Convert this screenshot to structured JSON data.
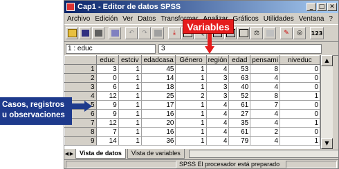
{
  "window": {
    "title": "Cap1 - Editor de datos SPSS"
  },
  "menu": [
    "Archivo",
    "Edición",
    "Ver",
    "Datos",
    "Transformar",
    "Analizar",
    "Gráficos",
    "Utilidades",
    "Ventana",
    "?"
  ],
  "cell": {
    "ref": "1 : educ",
    "value": "3"
  },
  "grid": {
    "columns": [
      "educ",
      "estciv",
      "edadcasa",
      "Género",
      "región",
      "edad",
      "pensami",
      "niveduc"
    ],
    "rows": [
      [
        "1",
        "3",
        "1",
        "45",
        "1",
        "4",
        "53",
        "8",
        "0"
      ],
      [
        "2",
        "0",
        "1",
        "14",
        "1",
        "3",
        "63",
        "4",
        "0"
      ],
      [
        "3",
        "6",
        "1",
        "18",
        "1",
        "3",
        "40",
        "4",
        "0"
      ],
      [
        "4",
        "12",
        "1",
        "25",
        "2",
        "3",
        "52",
        "8",
        "1"
      ],
      [
        "5",
        "9",
        "1",
        "17",
        "1",
        "4",
        "61",
        "7",
        "0"
      ],
      [
        "6",
        "9",
        "1",
        "16",
        "1",
        "4",
        "27",
        "4",
        "0"
      ],
      [
        "7",
        "12",
        "1",
        "20",
        "1",
        "4",
        "35",
        "4",
        "1"
      ],
      [
        "8",
        "7",
        "1",
        "16",
        "1",
        "4",
        "61",
        "2",
        "0"
      ],
      [
        "9",
        "14",
        "1",
        "36",
        "1",
        "4",
        "79",
        "4",
        "1"
      ]
    ]
  },
  "tabs": {
    "data_view": "Vista de datos",
    "variable_view": "Vista de variables"
  },
  "status": "SPSS El procesador  está preparado",
  "annotations": {
    "variables": "Variables",
    "cases": "Casos, registros u observaciones"
  },
  "colors": {
    "titlebar": "#0a246a",
    "callout_red": "#e51c1c",
    "callout_blue": "#1e3a8c"
  },
  "toolbar_icons": [
    "open-icon",
    "save-icon",
    "print-icon",
    "dialog-recall-icon",
    "undo-icon",
    "redo-icon",
    "goto-chart-icon",
    "goto-case-icon",
    "variables-icon",
    "find-icon",
    "insert-case-icon",
    "insert-variable-icon",
    "split-file-icon",
    "weight-cases-icon",
    "select-cases-icon",
    "value-labels-icon",
    "use-sets-icon"
  ]
}
